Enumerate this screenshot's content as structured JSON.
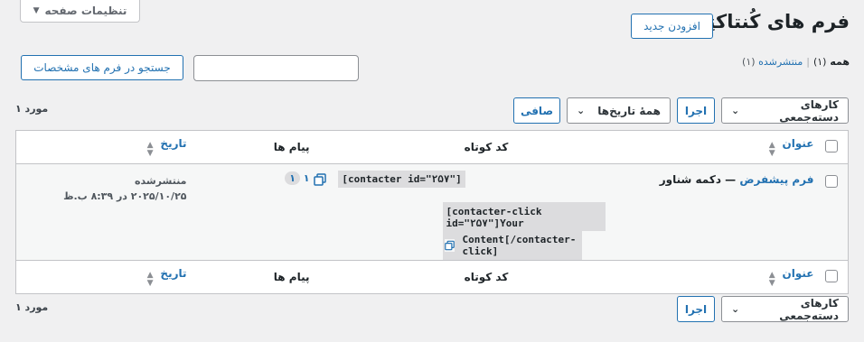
{
  "screen_options": {
    "label": "تنظیمات صفحه",
    "chevron": "▼"
  },
  "header": {
    "title": "فرم های کُنتاکتِر",
    "add_new": "افزودن جدید"
  },
  "filters": {
    "all_label": "همه",
    "all_count": "(۱)",
    "separator": "|",
    "published_label": "منتشرشده",
    "published_count": "(۱)"
  },
  "search": {
    "placeholder": "",
    "button": "جستجو در فرم های مشخصات"
  },
  "bulk": {
    "action_label": "کارهای دسته‌جمعی",
    "apply": "اجرا"
  },
  "dates": {
    "label": "همهٔ تاریخ‌ها"
  },
  "filter_button": "صافی",
  "items_count": "۱ مورد",
  "table": {
    "headers": {
      "title": "عنوان",
      "shortcode": "کد کوتاه",
      "messages": "پیام ها",
      "date": "تاریخ"
    },
    "rows": [
      {
        "title_link": "فرم پیشفرض",
        "title_suffix": " — دکمه شناور",
        "shortcode1": "[contacter id=\"۲۵۷\"]",
        "shortcode2_line1": "[contacter-click id=\"۲۵۷\"]Your",
        "shortcode2_line2": "Content[/contacter-click]",
        "messages_count": "۱",
        "messages_bubble": "۱",
        "status": "منتشرشده",
        "date": "۲۰۲۵/۱۰/۲۵ در ۸:۳۹ ب.ظ"
      }
    ]
  },
  "icons": {
    "sort": "sort-icon",
    "copy": "copy-icon",
    "chevron": "chevron-down-icon"
  }
}
